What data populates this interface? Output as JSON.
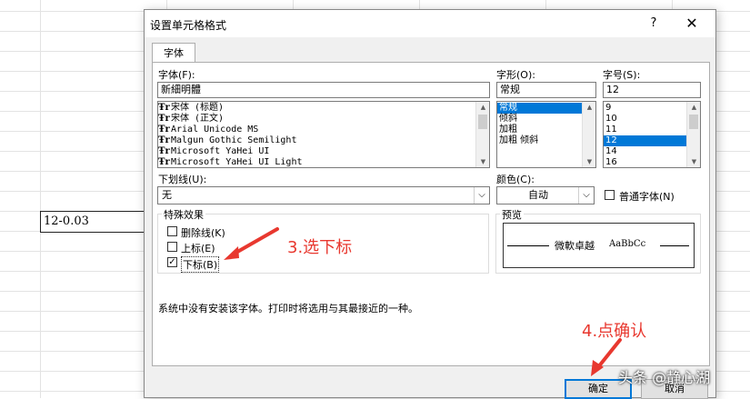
{
  "sheet": {
    "cell_value": "12-0.03"
  },
  "dialog": {
    "title": "设置单元格格式",
    "help": "?",
    "close": "✕",
    "tab": "字体",
    "font_label": "字体(F):",
    "font_value": "新細明體",
    "font_list": [
      "宋体 (标题)",
      "宋体 (正文)",
      "Arial Unicode MS",
      "Malgun Gothic Semilight",
      "Microsoft YaHei UI",
      "Microsoft YaHei UI Light"
    ],
    "style_label": "字形(O):",
    "style_value": "常规",
    "style_list": [
      "常规",
      "倾斜",
      "加粗",
      "加粗 倾斜"
    ],
    "size_label": "字号(S):",
    "size_value": "12",
    "size_list": [
      "9",
      "10",
      "11",
      "12",
      "14",
      "16"
    ],
    "underline_label": "下划线(U):",
    "underline_value": "无",
    "color_label": "颜色(C):",
    "color_value": "自动",
    "normal_font_label": "普通字体(N)",
    "effects_label": "特殊效果",
    "strikethrough_label": "删除线(K)",
    "superscript_label": "上标(E)",
    "subscript_label": "下标(B)",
    "preview_label": "预览",
    "preview_text": "微軟卓越",
    "preview_sample": "AaBbCc",
    "message": "系统中没有安装该字体。打印时将选用与其最接近的一种。",
    "ok_label": "确定",
    "cancel_label": "取消"
  },
  "annotations": {
    "step3": "3.选下标",
    "step4": "4.点确认"
  },
  "watermark": "头条 @静心湖",
  "colors": {
    "annotation": "#e8382f",
    "selection": "#0078d7"
  }
}
